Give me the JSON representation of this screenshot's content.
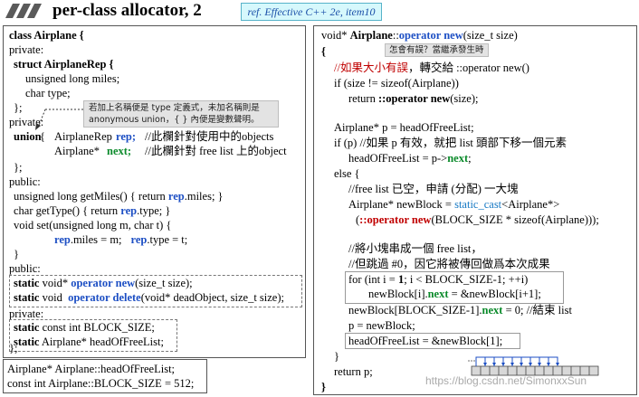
{
  "header": {
    "title": "per-class allocator, 2",
    "ref": "ref. Effective C++ 2e, item10"
  },
  "left": {
    "lines": [
      "class Airplane {",
      "private:",
      "struct AirplaneRep {",
      "unsigned long miles;",
      "char type;",
      "};",
      "private:",
      "union",
      "{",
      "AirplaneRep",
      "rep;",
      "//此欄針對使用中的objects",
      "Airplane*",
      "next;",
      "//此欄針對 free list 上的object",
      "};",
      "public:",
      "unsigned long getMiles() { return ",
      "rep",
      ".miles; }",
      "char getType() { return ",
      "rep",
      ".type; }",
      "void set(unsigned long m, char t)   {",
      "rep",
      ".miles = m;",
      "rep",
      ".type = t;",
      "}",
      "public:",
      "static",
      "void*",
      "operator new",
      "(size_t size);",
      "static",
      "void",
      "operator delete",
      "(void* deadObject, size_t size);",
      "private:",
      "static",
      "const int BLOCK_SIZE;",
      "static",
      "Airplane* headOfFreeList;",
      "};"
    ],
    "note": [
      "若加上名稱便是 type 定義式，未加名稱則是",
      "anonymous union，{ } 內便是變數聲明。"
    ]
  },
  "left2": {
    "lines": [
      "Airplane* Airplane::headOfFreeList;",
      "const int Airplane::BLOCK_SIZE = 512;"
    ]
  },
  "right": {
    "lines": [
      "void* ",
      "Airplane",
      "::",
      "operator new",
      "(size_t size)",
      "{",
      "//如果大小有誤",
      "，轉交給 ::operator new()",
      "if (size != sizeof(Airplane))",
      "return ",
      "::operator new",
      "(size);",
      "Airplane* p = headOfFreeList;",
      "if (p)  //如果 p 有效，就把 list 頭部下移一個元素",
      "headOfFreeList = p->",
      "next",
      ";",
      "else {",
      "//free list 已空，申請 (分配) 一大塊",
      "Airplane* newBlock = ",
      "static_cast",
      "<Airplane*>",
      "(",
      "::operator new",
      "(BLOCK_SIZE * sizeof(Airplane)));",
      "//將小塊串成一個 free list，",
      "//但跳過 #0，因它將被傳回做爲本次成果",
      "for (int i = ",
      "1",
      "; i < BLOCK_SIZE-1; ++i)",
      "newBlock[i].",
      "next",
      " = &newBlock[i+1];",
      "newBlock[BLOCK_SIZE-1].",
      "next",
      " = 0;   //結束 list",
      "p = newBlock;",
      "headOfFreeList = &newBlock[1];",
      "}",
      "return p;",
      "}"
    ],
    "note": "怎會有誤？當繼承發生時"
  },
  "watermark": "https://blog.csdn.net/SimonxxSun",
  "colors": {
    "keyword_blue": "#1d4fc4",
    "member_green": "#0a8a2a",
    "comment_red": "#c00000",
    "cast_blue": "#1779c4",
    "ref_bg": "#d6f8fc",
    "note_bg": "#e3e3e3"
  }
}
